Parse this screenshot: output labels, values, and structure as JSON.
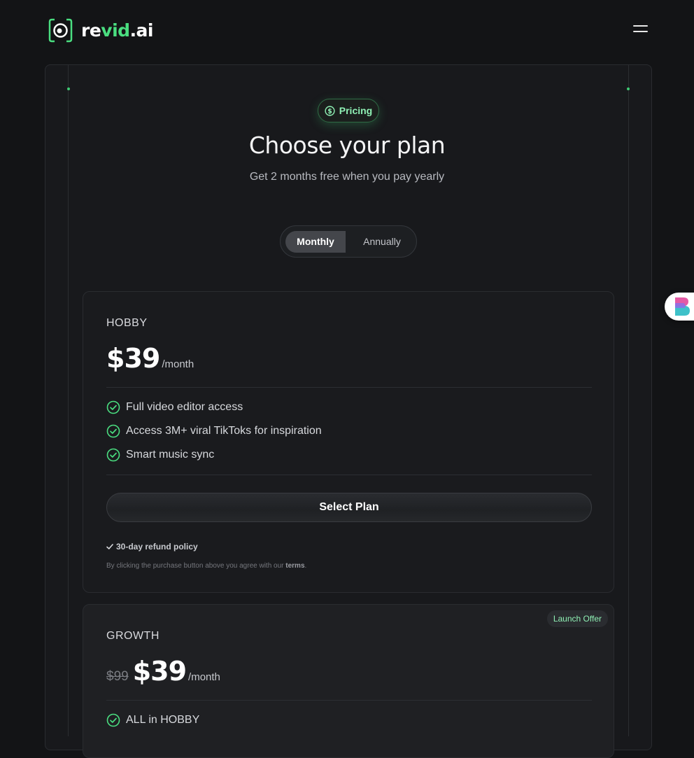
{
  "brand": {
    "name_prefix": "re",
    "name_highlight": "vid",
    "name_suffix": ".ai"
  },
  "header": {
    "menu_icon": "hamburger-menu-icon"
  },
  "hero": {
    "badge_icon": "dollar-circle-icon",
    "badge_label": "Pricing",
    "title": "Choose your plan",
    "subtitle": "Get 2 months free when you pay yearly"
  },
  "billing_toggle": {
    "options": [
      "Monthly",
      "Annually"
    ],
    "selected": "Monthly"
  },
  "plans": [
    {
      "name": "HOBBY",
      "price": "$39",
      "period": "/month",
      "features": [
        "Full video editor access",
        "Access 3M+ viral TikToks for inspiration",
        "Smart music sync"
      ],
      "cta": "Select Plan",
      "refund": "30-day refund policy",
      "legal_prefix": "By clicking the purchase button above you agree with our ",
      "legal_link": "terms",
      "legal_suffix": "."
    },
    {
      "name": "GROWTH",
      "badge": "Launch Offer",
      "old_price": "$99",
      "price": "$39",
      "period": "/month",
      "features": [
        "ALL in HOBBY"
      ]
    }
  ],
  "colors": {
    "accent": "#4ade80",
    "background": "#131416",
    "card": "#1a1b1e"
  }
}
